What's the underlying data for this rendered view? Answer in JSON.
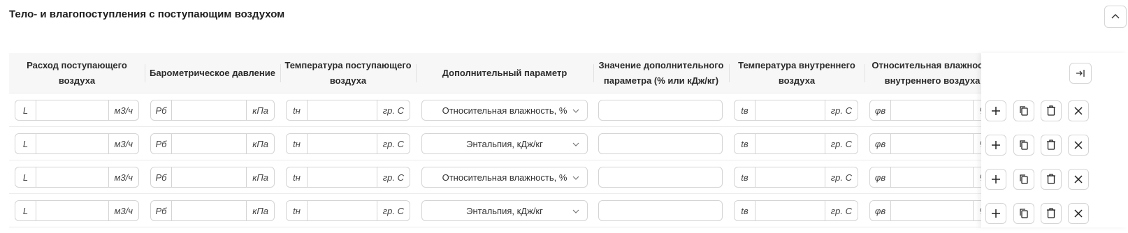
{
  "section": {
    "title": "Тело- и влагопоступления с поступающим воздухом"
  },
  "columns": [
    "Расход поступающего воздуха",
    "Барометрическое давление",
    "Температура поступающего воздуха",
    "Дополнительный параметр",
    "Значение дополнительного параметра (% или кДж/кг)",
    "Температура внутреннего воздуха",
    "Относительная влажность внутреннего воздуха"
  ],
  "units": {
    "flow": {
      "prefix": "L",
      "suffix": "м3/ч"
    },
    "pressure": {
      "prefix": "Рб",
      "suffix": "кПа"
    },
    "temp_in": {
      "prefix": "tн",
      "suffix": "гр. С"
    },
    "temp_int": {
      "prefix": "tв",
      "suffix": "гр. С"
    },
    "humidity_int": {
      "prefix": "φв",
      "suffix": "%"
    }
  },
  "rows": [
    {
      "extra_param": "Относительная влажность, %"
    },
    {
      "extra_param": "Энтальпия, кДж/кг"
    },
    {
      "extra_param": "Относительная влажность, %"
    },
    {
      "extra_param": "Энтальпия, кДж/кг"
    }
  ],
  "icons": {
    "collapse": "chevron-up-icon",
    "pin": "pin-right-icon",
    "add": "plus-icon",
    "copy": "copy-icon",
    "delete": "trash-icon",
    "remove": "close-icon"
  }
}
